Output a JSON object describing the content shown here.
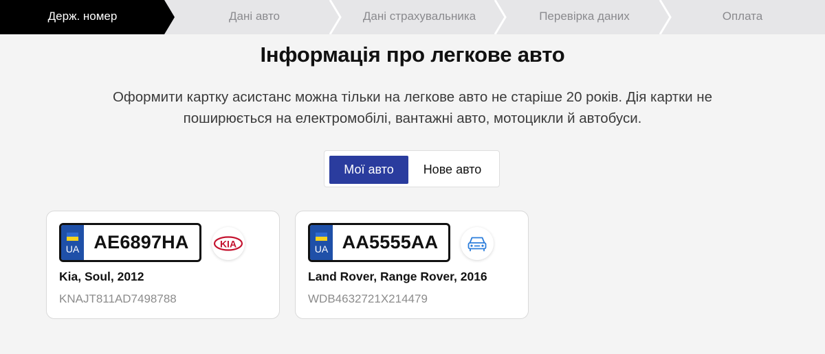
{
  "stepper": {
    "steps": [
      {
        "label": "Держ. номер",
        "active": true
      },
      {
        "label": "Дані авто",
        "active": false
      },
      {
        "label": "Дані страхувальника",
        "active": false
      },
      {
        "label": "Перевірка даних",
        "active": false
      },
      {
        "label": "Оплата",
        "active": false
      }
    ]
  },
  "page": {
    "title": "Інформація про легкове авто",
    "description": "Оформити картку асистанс можна тільки на легкове авто не старіше 20 років. Дія картки не поширюється на електромобілі, вантажні авто, мотоцикли й автобуси."
  },
  "toggle": {
    "options": [
      "Мої авто",
      "Нове авто"
    ],
    "selected": "Мої авто"
  },
  "cars": [
    {
      "country_code": "UA",
      "plate": "AE6897HA",
      "brand_logo_text": "KIA",
      "logo_icon": "kia-logo",
      "name": "Kia, Soul, 2012",
      "vin": "KNAJT811AD7498788"
    },
    {
      "country_code": "UA",
      "plate": "AA5555AA",
      "logo_icon": "car-icon",
      "name": "Land Rover, Range Rover, 2016",
      "vin": "WDB4632721X214479"
    }
  ],
  "colors": {
    "active_step_bg": "#000000",
    "stepper_bg": "#e6e6e8",
    "accent": "#2a3c9e",
    "kia_red": "#c4122e",
    "car_icon_blue": "#2b7ddb",
    "plate_band": "#1f50a8"
  }
}
